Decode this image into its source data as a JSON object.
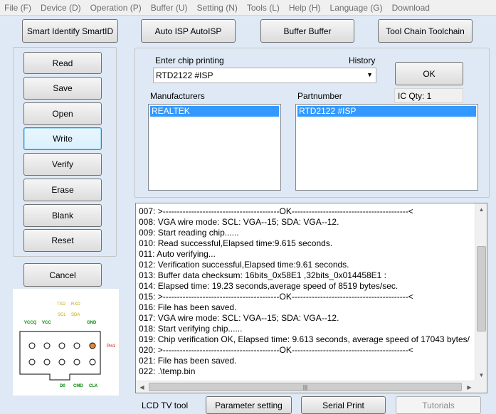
{
  "menu": [
    "File (F)",
    "Device (D)",
    "Operation (P)",
    "Buffer (U)",
    "Setting (N)",
    "Tools (L)",
    "Help (H)",
    "Language (G)",
    "Download"
  ],
  "toolbar": {
    "smart_identify": "Smart Identify SmartID",
    "auto_isp": "Auto ISP AutoISP",
    "buffer": "Buffer Buffer",
    "tool_chain": "Tool Chain Toolchain"
  },
  "actions": {
    "read": "Read",
    "save": "Save",
    "open": "Open",
    "write": "Write",
    "verify": "Verify",
    "erase": "Erase",
    "blank": "Blank",
    "reset": "Reset",
    "cancel": "Cancel"
  },
  "chip": {
    "enter_label": "Enter chip printing",
    "history_label": "History",
    "input_value": "RTD2122 #ISP",
    "ok_label": "OK",
    "manufacturers_label": "Manufacturers",
    "partnumber_label": "Partnumber",
    "ic_qty": "IC Qty: 1",
    "manufacturers": [
      "REALTEK"
    ],
    "partnumbers": [
      "RTD2122 #ISP"
    ]
  },
  "log": [
    "007:  >-----------------------------------------OK-----------------------------------------<",
    "008:  VGA wire mode: SCL: VGA--15; SDA: VGA--12.",
    "009:  Start reading chip......",
    "010:  Read successful,Elapsed time:9.615 seconds.",
    "011:  Auto verifying...",
    "012:  Verification successful,Elapsed time:9.61 seconds.",
    "013:  Buffer data checksum: 16bits_0x58E1 ,32bits_0x014458E1 :",
    "014:  Elapsed time: 19.23 seconds,average speed of 8519 bytes/sec.",
    "015:  >-----------------------------------------OK-----------------------------------------<",
    "016:  File has been saved.",
    "017:  VGA wire mode: SCL: VGA--15; SDA: VGA--12.",
    "018:  Start verifying chip......",
    "019:  Chip verification OK, Elapsed time: 9.613 seconds, average speed of 17043 bytes/",
    "020:  >-----------------------------------------OK-----------------------------------------<",
    "021:  File has been saved.",
    "022:  .\\temp.bin"
  ],
  "bottom": {
    "lcd_tv_tool": "LCD TV tool",
    "parameter_setting": "Parameter setting",
    "serial_print": "Serial Print",
    "tutorials": "Tutorials"
  },
  "pinout": {
    "txd": "TXD",
    "rxd": "RXD",
    "scl": "SCL",
    "sda": "SDA",
    "vccq": "VCCQ",
    "vcc": "VCC",
    "gnd": "GND",
    "pin1": "Pin1",
    "d0": "D0",
    "cmd": "CMD",
    "clk": "CLK"
  },
  "colors": {
    "selection": "#3399ff",
    "pin_highlight": "#e08a3c",
    "pin_label_yellow": "#c8a400",
    "pin_label_green": "#0a8a0a",
    "pin_label_red": "#cc0000"
  }
}
